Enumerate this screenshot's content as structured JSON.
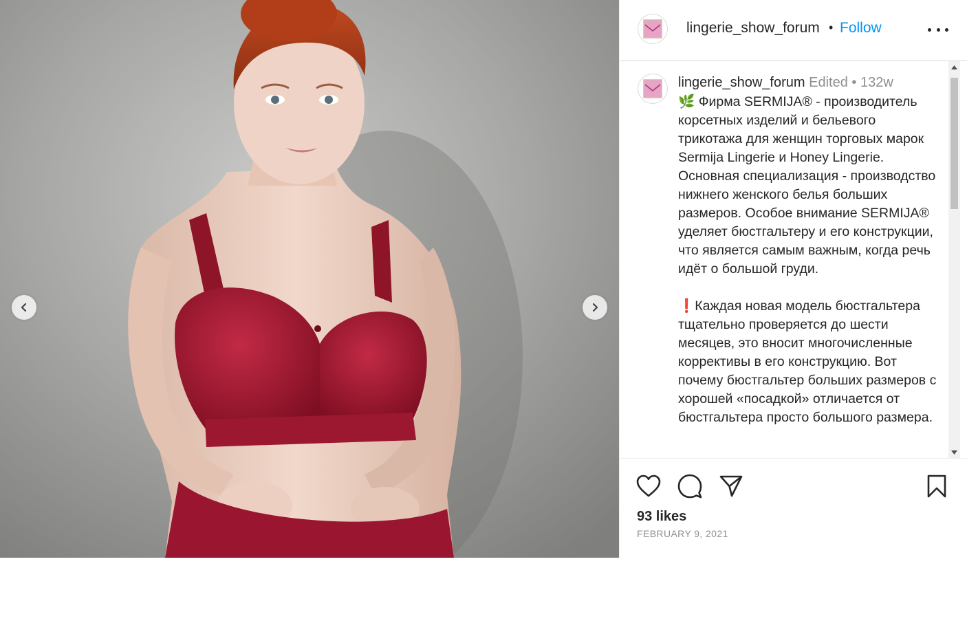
{
  "post": {
    "username": "lingerie_show_forum",
    "follow_label": "Follow",
    "separator": "•",
    "caption": {
      "username": "lingerie_show_forum",
      "edited": "Edited",
      "separator": "•",
      "time_ago": "132w",
      "text": "🌿 Фирма SERMIJA® - производитель корсетных изделий и бельевого трикотажа для женщин торговых марок Sermija Lingerie и Honey Lingerie. Основная специализация - производство нижнего женского белья больших размеров. Особое внимание SERMIJA® уделяет бюстгальтеру и его конструкции, что является самым важным, когда речь идёт о большой груди.\n\n❗Каждая новая модель бюстгальтера тщательно проверяется до шести месяцев, это вносит многочисленные коррективы в его конструкцию. Вот почему бюстгальтер больших размеров с хорошей «посадкой» отличается от бюстгальтера просто большого размера."
    },
    "likes": "93 likes",
    "date": "FEBRUARY 9, 2021"
  },
  "icons": {
    "prev": "chevron-left-icon",
    "next": "chevron-right-icon",
    "like": "heart-icon",
    "comment": "comment-icon",
    "share": "paper-plane-icon",
    "save": "bookmark-icon",
    "more": "more-options-icon"
  },
  "colors": {
    "follow": "#0095f6",
    "garment": "#a3152e",
    "wall": "#a9a9a7"
  }
}
